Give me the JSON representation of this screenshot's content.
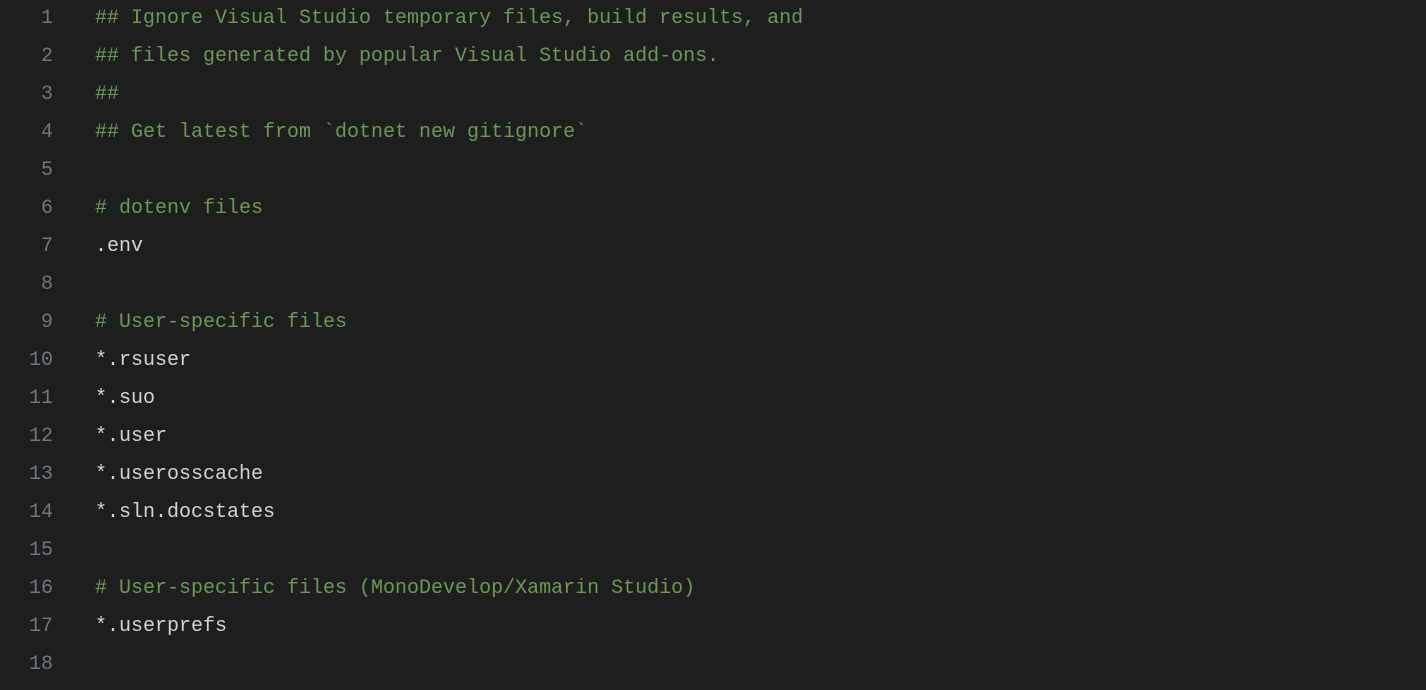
{
  "editor": {
    "lines": [
      {
        "number": "1",
        "tokens": [
          {
            "cls": "comment",
            "t": "## Ignore Visual Studio temporary files, build results, and"
          }
        ]
      },
      {
        "number": "2",
        "tokens": [
          {
            "cls": "comment",
            "t": "## files generated by popular Visual Studio add-ons."
          }
        ]
      },
      {
        "number": "3",
        "tokens": [
          {
            "cls": "comment",
            "t": "##"
          }
        ]
      },
      {
        "number": "4",
        "tokens": [
          {
            "cls": "comment",
            "t": "## Get latest from `dotnet new gitignore`"
          }
        ]
      },
      {
        "number": "5",
        "tokens": [
          {
            "cls": "text",
            "t": ""
          }
        ]
      },
      {
        "number": "6",
        "tokens": [
          {
            "cls": "comment",
            "t": "# dotenv files"
          }
        ]
      },
      {
        "number": "7",
        "tokens": [
          {
            "cls": "text",
            "t": ".env"
          }
        ]
      },
      {
        "number": "8",
        "tokens": [
          {
            "cls": "text",
            "t": ""
          }
        ]
      },
      {
        "number": "9",
        "tokens": [
          {
            "cls": "comment",
            "t": "# User-specific files"
          }
        ]
      },
      {
        "number": "10",
        "tokens": [
          {
            "cls": "text",
            "t": "*.rsuser"
          }
        ]
      },
      {
        "number": "11",
        "tokens": [
          {
            "cls": "text",
            "t": "*.suo"
          }
        ]
      },
      {
        "number": "12",
        "tokens": [
          {
            "cls": "text",
            "t": "*.user"
          }
        ]
      },
      {
        "number": "13",
        "tokens": [
          {
            "cls": "text",
            "t": "*.userosscache"
          }
        ]
      },
      {
        "number": "14",
        "tokens": [
          {
            "cls": "text",
            "t": "*.sln.docstates"
          }
        ]
      },
      {
        "number": "15",
        "tokens": [
          {
            "cls": "text",
            "t": ""
          }
        ]
      },
      {
        "number": "16",
        "tokens": [
          {
            "cls": "comment",
            "t": "# User-specific files (MonoDevelop/Xamarin Studio)"
          }
        ]
      },
      {
        "number": "17",
        "tokens": [
          {
            "cls": "text",
            "t": "*.userprefs"
          }
        ]
      },
      {
        "number": "18",
        "tokens": [
          {
            "cls": "text",
            "t": ""
          }
        ]
      }
    ]
  }
}
